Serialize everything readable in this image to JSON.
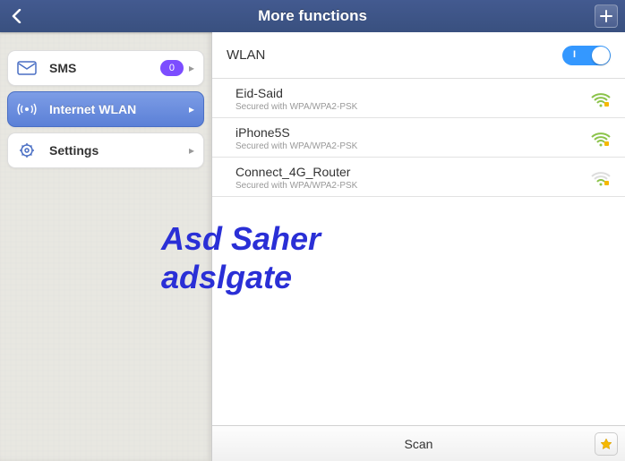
{
  "header": {
    "title": "More functions"
  },
  "sidebar": {
    "items": [
      {
        "label": "SMS",
        "badge": "0",
        "active": false
      },
      {
        "label": "Internet WLAN",
        "active": true
      },
      {
        "label": "Settings",
        "active": false
      }
    ]
  },
  "content": {
    "title": "WLAN",
    "toggle_on": true,
    "networks": [
      {
        "name": "Eid-Said",
        "security": "Secured with WPA/WPA2-PSK",
        "strength": 3
      },
      {
        "name": "iPhone5S",
        "security": "Secured with WPA/WPA2-PSK",
        "strength": 3
      },
      {
        "name": "Connect_4G_Router",
        "security": "Secured with WPA/WPA2-PSK",
        "strength": 1
      }
    ]
  },
  "footer": {
    "scan_label": "Scan"
  },
  "watermark": {
    "line1": "Asd Saher",
    "line2": "adslgate"
  }
}
